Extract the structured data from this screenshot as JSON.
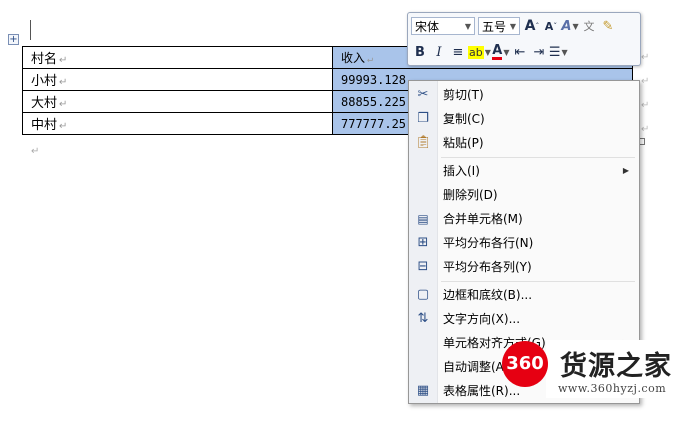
{
  "table": {
    "move_handle": "+",
    "header": {
      "col1": "村名",
      "col2": "收入"
    },
    "rows": [
      {
        "col1": "小村",
        "col2": "99993.128"
      },
      {
        "col1": "大村",
        "col2": "88855.225"
      },
      {
        "col1": "中村",
        "col2": "777777.25"
      }
    ],
    "cell_mark": "↵",
    "paragraph_mark": "↵"
  },
  "mini_toolbar": {
    "font_name": "宋体",
    "font_size": "五号",
    "grow_font": "A",
    "shrink_font": "A",
    "bold": "B",
    "italic": "I",
    "font_color": "A"
  },
  "context_menu": {
    "items": [
      {
        "label": "剪切(T)",
        "icon": "scissors-icon"
      },
      {
        "label": "复制(C)",
        "icon": "copy-icon"
      },
      {
        "label": "粘贴(P)",
        "icon": "paste-icon"
      },
      {
        "label": "插入(I)",
        "icon": "",
        "submenu": true
      },
      {
        "label": "删除列(D)",
        "icon": ""
      },
      {
        "label": "合并单元格(M)",
        "icon": "merge-cells-icon"
      },
      {
        "label": "平均分布各行(N)",
        "icon": "distribute-rows-icon"
      },
      {
        "label": "平均分布各列(Y)",
        "icon": "distribute-columns-icon"
      },
      {
        "label": "边框和底纹(B)...",
        "icon": "borders-icon"
      },
      {
        "label": "文字方向(X)...",
        "icon": "text-direction-icon"
      },
      {
        "label": "单元格对齐方式(G)",
        "icon": "",
        "submenu": true
      },
      {
        "label": "自动调整(A)",
        "icon": "",
        "submenu": true
      },
      {
        "label": "表格属性(R)...",
        "icon": "table-properties-icon"
      }
    ]
  },
  "watermark": {
    "badge": "360",
    "title": "货源之家",
    "url": "www.360hyzj.com"
  },
  "colors": {
    "selection": "#a9c4ea",
    "watermark_red": "#e60012"
  }
}
